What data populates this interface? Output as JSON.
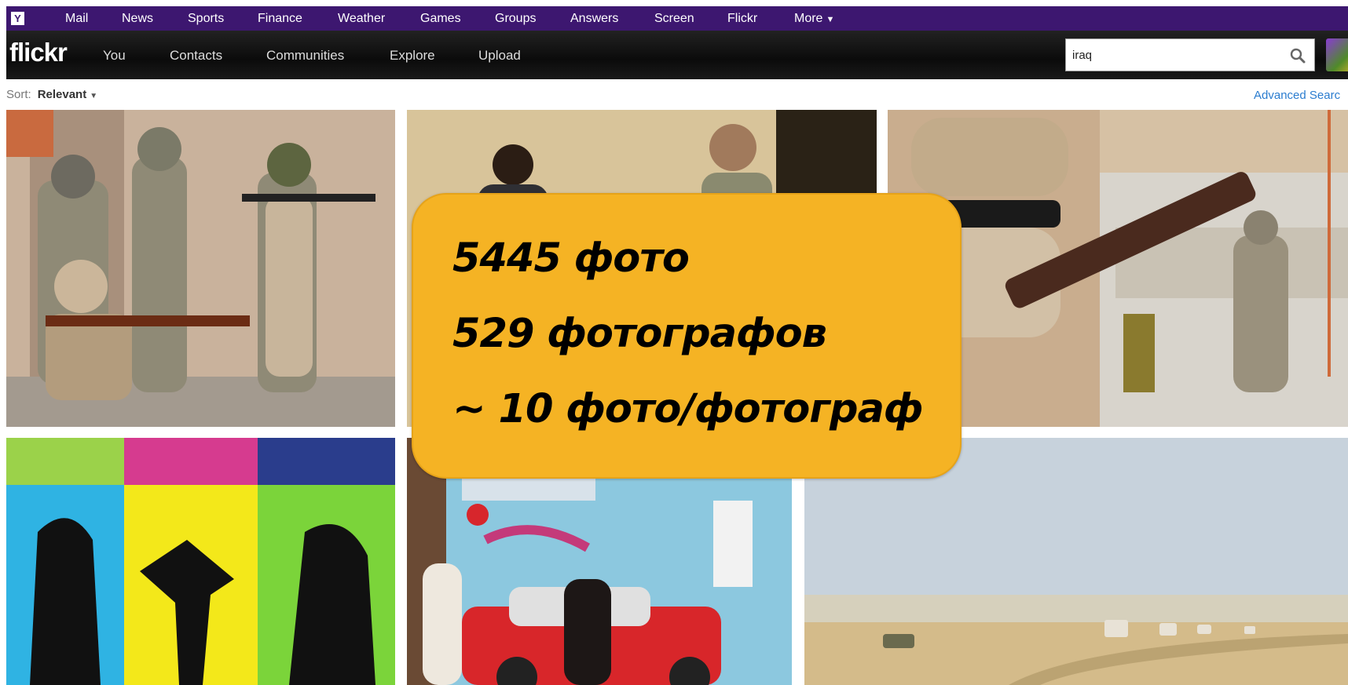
{
  "yahoo_bar": {
    "logo": "Y",
    "links": [
      "Mail",
      "News",
      "Sports",
      "Finance",
      "Weather",
      "Games",
      "Groups",
      "Answers",
      "Screen",
      "Flickr",
      "More"
    ],
    "more_icon": "chevron-down-icon"
  },
  "flickr_bar": {
    "logo": "flickr",
    "nav": [
      "You",
      "Contacts",
      "Communities",
      "Explore",
      "Upload"
    ],
    "search_value": "iraq",
    "search_icon": "search-icon"
  },
  "sort": {
    "label": "Sort:",
    "value": "Relevant"
  },
  "advanced_search_label": "Advanced Searc",
  "photos": [
    {
      "subject": "soldiers-training"
    },
    {
      "subject": "soldiers-street"
    },
    {
      "subject": "masked-soldier-rpg"
    },
    {
      "subject": "ipod-posters"
    },
    {
      "subject": "street-graffiti-red-car"
    },
    {
      "subject": "desert-convoy"
    }
  ],
  "overlay": {
    "line1": "5445 фото",
    "line2": "529 фотографов",
    "line3": "~ 10 фото/фотограф"
  },
  "colors": {
    "yahoo_purple": "#3d1770",
    "overlay_yellow": "#f5b324",
    "link_blue": "#2a7ccf"
  }
}
